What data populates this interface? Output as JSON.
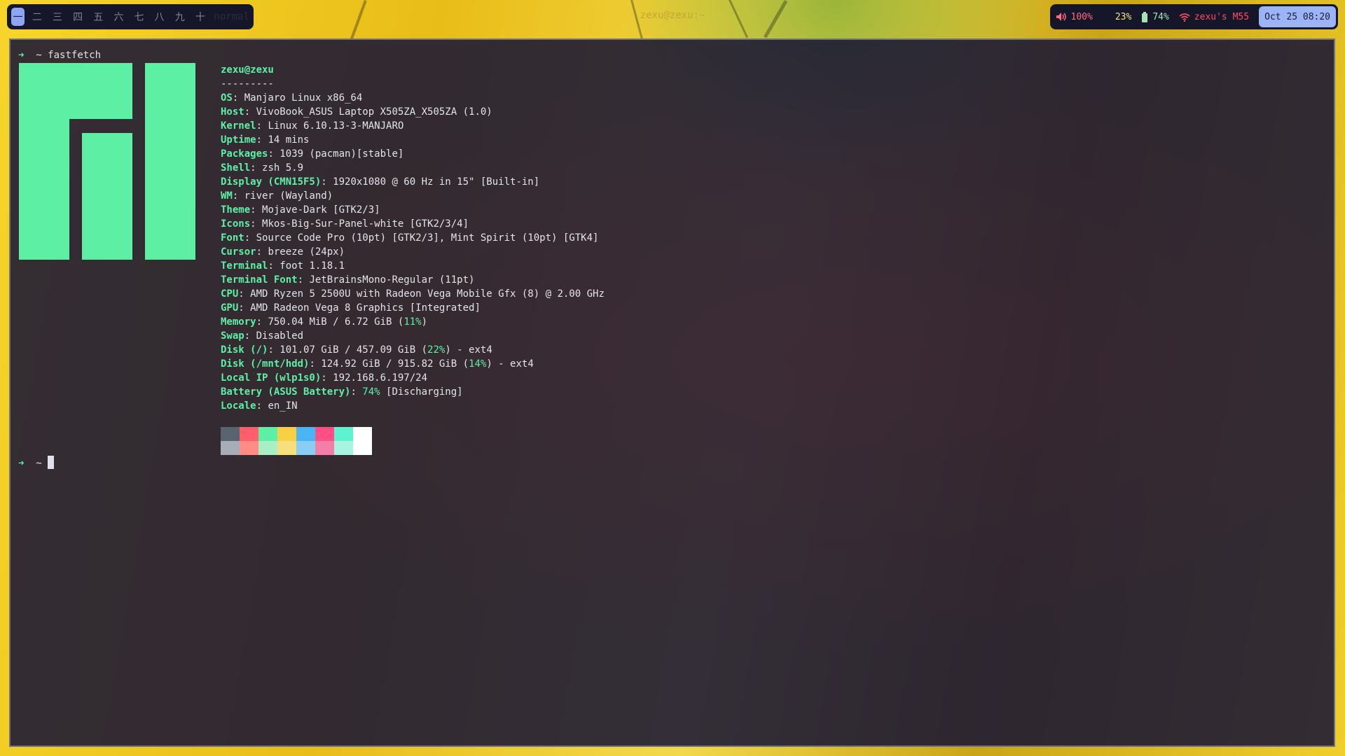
{
  "workspaces": {
    "items": [
      "一",
      "二",
      "三",
      "四",
      "五",
      "六",
      "七",
      "八",
      "九",
      "十"
    ],
    "active_index": 0,
    "mode": "normal"
  },
  "window_title": "zexu@zexu:~",
  "status": {
    "volume": "100%",
    "brightness": "23%",
    "battery": "74%",
    "wifi": "zexu's M55",
    "clock": "Oct 25 08:20",
    "icons": [
      "volume-icon",
      "moon-icon",
      "battery-icon",
      "wifi-icon"
    ]
  },
  "terminal": {
    "prompt_arrow": "➜",
    "prompt_dir": "~",
    "command": "fastfetch",
    "user_host": "zexu@zexu",
    "separator": "---------",
    "info": [
      {
        "key": "OS",
        "value": "Manjaro Linux x86_64"
      },
      {
        "key": "Host",
        "value": "VivoBook_ASUS Laptop X505ZA_X505ZA (1.0)"
      },
      {
        "key": "Kernel",
        "value": "Linux 6.10.13-3-MANJARO"
      },
      {
        "key": "Uptime",
        "value": "14 mins"
      },
      {
        "key": "Packages",
        "value": "1039 (pacman)[stable]"
      },
      {
        "key": "Shell",
        "value": "zsh 5.9"
      },
      {
        "key": "Display (CMN15F5)",
        "value": "1920x1080 @ 60 Hz in 15\" [Built-in]"
      },
      {
        "key": "WM",
        "value": "river (Wayland)"
      },
      {
        "key": "Theme",
        "value": "Mojave-Dark [GTK2/3]"
      },
      {
        "key": "Icons",
        "value": "Mkos-Big-Sur-Panel-white [GTK2/3/4]"
      },
      {
        "key": "Font",
        "value": "Source Code Pro (10pt) [GTK2/3], Mint Spirit (10pt) [GTK4]"
      },
      {
        "key": "Cursor",
        "value": "breeze (24px)"
      },
      {
        "key": "Terminal",
        "value": "foot 1.18.1"
      },
      {
        "key": "Terminal Font",
        "value": "JetBrainsMono-Regular (11pt)"
      },
      {
        "key": "CPU",
        "value": "AMD Ryzen 5 2500U with Radeon Vega Mobile Gfx (8) @ 2.00 GHz"
      },
      {
        "key": "GPU",
        "value": "AMD Radeon Vega 8 Graphics [Integrated]"
      },
      {
        "key": "Memory",
        "value": "750.04 MiB / 6.72 GiB (",
        "pct": "11%",
        "tail": ")"
      },
      {
        "key": "Swap",
        "value": "Disabled"
      },
      {
        "key": "Disk (/)",
        "value": "101.07 GiB / 457.09 GiB (",
        "pct": "22%",
        "tail": ") - ext4"
      },
      {
        "key": "Disk (/mnt/hdd)",
        "value": "124.92 GiB / 915.82 GiB (",
        "pct": "14%",
        "tail": ") - ext4"
      },
      {
        "key": "Local IP (wlp1s0)",
        "value": "192.168.6.197/24"
      },
      {
        "key": "Battery (ASUS Battery)",
        "value": "",
        "pct": "74%",
        "tail": " [Discharging]"
      },
      {
        "key": "Locale",
        "value": "en_IN"
      }
    ],
    "palette": {
      "top": [
        "#5a6470",
        "#ff5f6b",
        "#5df0a4",
        "#f7d046",
        "#4ab4f5",
        "#ff4f84",
        "#5ff2d0",
        "#ffffff"
      ],
      "bottom": [
        "#a7adb6",
        "#ff8d86",
        "#a9efc6",
        "#f7df7c",
        "#89cdf5",
        "#f37ea7",
        "#a7f4e1",
        "#ffffff"
      ]
    }
  },
  "colors": {
    "accent_green": "#5df0a4",
    "bar_bg": "#16162a",
    "clock_bg": "#9cb4f6",
    "terminal_bg": "#141234"
  }
}
